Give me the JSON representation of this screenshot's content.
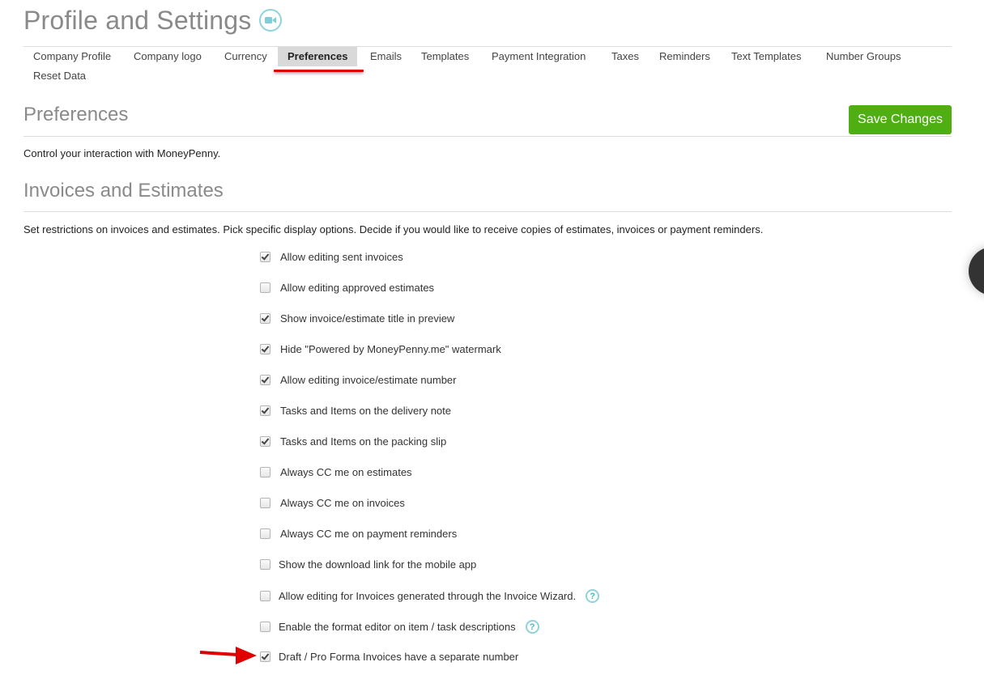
{
  "page": {
    "title": "Profile and Settings",
    "title_icon": "video-camera-icon"
  },
  "tabs": [
    {
      "label": "Company Profile",
      "active": false
    },
    {
      "label": "Company logo",
      "active": false
    },
    {
      "label": "Currency",
      "active": false
    },
    {
      "label": "Preferences",
      "active": true
    },
    {
      "label": "Emails",
      "active": false
    },
    {
      "label": "Templates",
      "active": false
    },
    {
      "label": "Payment Integration",
      "active": false
    },
    {
      "label": "Taxes",
      "active": false
    },
    {
      "label": "Reminders",
      "active": false
    },
    {
      "label": "Text Templates",
      "active": false
    },
    {
      "label": "Number Groups",
      "active": false
    },
    {
      "label": "Reset Data",
      "active": false
    }
  ],
  "preferences": {
    "title": "Preferences",
    "save_label": "Save Changes",
    "description": "Control your interaction with MoneyPenny."
  },
  "invoices": {
    "title": "Invoices and Estimates",
    "description": "Set restrictions on invoices and estimates. Pick specific display options. Decide if you would like to receive copies of estimates, invoices or payment reminders.",
    "options": [
      {
        "label": "Allow editing sent invoices",
        "checked": true,
        "help": false
      },
      {
        "label": "Allow editing approved estimates",
        "checked": false,
        "help": false
      },
      {
        "label": "Show invoice/estimate title in preview",
        "checked": true,
        "help": false
      },
      {
        "label": "Hide \"Powered by MoneyPenny.me\" watermark",
        "checked": true,
        "help": false
      },
      {
        "label": "Allow editing invoice/estimate number",
        "checked": true,
        "help": false
      },
      {
        "label": "Tasks and Items on the delivery note",
        "checked": true,
        "help": false
      },
      {
        "label": "Tasks and Items on the packing slip",
        "checked": true,
        "help": false
      },
      {
        "label": "Always CC me on estimates",
        "checked": false,
        "help": false
      },
      {
        "label": "Always CC me on invoices",
        "checked": false,
        "help": false
      },
      {
        "label": "Always CC me on payment reminders",
        "checked": false,
        "help": false
      },
      {
        "label": "Show the download link for the mobile app",
        "checked": false,
        "help": false
      },
      {
        "label": "Allow editing for Invoices generated through the Invoice Wizard.",
        "checked": false,
        "help": true
      },
      {
        "label": "Enable the format editor on item / task descriptions",
        "checked": false,
        "help": true
      },
      {
        "label": "Draft / Pro Forma Invoices have a separate number",
        "checked": true,
        "help": false
      }
    ]
  },
  "help_glyph": "?",
  "colors": {
    "accent_green": "#4fae12",
    "help_teal": "#8fd3dc",
    "annotation_red": "#e10000"
  }
}
